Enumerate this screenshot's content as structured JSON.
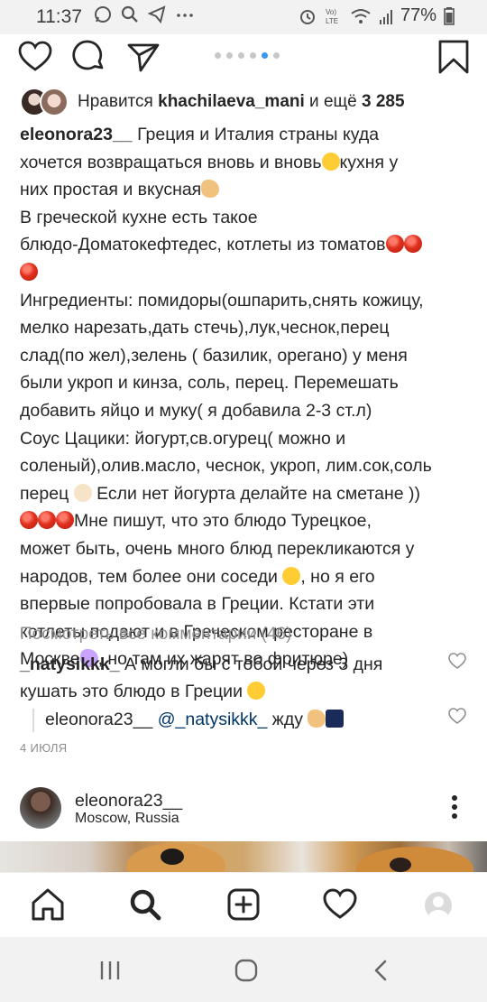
{
  "status_bar": {
    "time": "11:37",
    "battery": "77%"
  },
  "post": {
    "likes": {
      "prefix": "Нравится ",
      "user": "khachilaeva_mani",
      "middle": " и ещё ",
      "count": "3 285"
    },
    "caption": {
      "user": "eleonora23__",
      "l1": " Греция и Италия страны куда",
      "l2": "хочется возвращаться вновь и вновь",
      "l2b": "кухня у",
      "l3": "них простая и вкусная",
      "l4": "В греческой кухне есть такое",
      "l5": "блюдо-Доматокефтедес, котлеты из томатов",
      "l7": "Ингредиенты: помидоры(ошпарить,снять кожицу,",
      "l8": "мелко нарезать,дать стечь),лук,чеснок,перец",
      "l9": "слад(по жел),зелень ( базилик, орегано) у меня",
      "l10": "были укроп и кинза, соль, перец. Перемешать",
      "l11": "добавить яйцо и муку( я добавила 2-3 ст.л)",
      "l12": "Соус Цацики: йогурт,св.огурец( можно и",
      "l13": "соленый),олив.масло, чеснок, укроп, лим.сок,соль",
      "l14a": "перец ",
      "l14b": " Если нет йогурта делайте на сметане ))",
      "l15": "Мне пишут, что это блюдо Турецкое,",
      "l16": "может быть, очень много блюд перекликаются у",
      "l17a": "народов, тем более они соседи ",
      "l17b": ", но я его",
      "l18": "впервые попробовала в Греции. Кстати эти",
      "l19": "котлеты подают и в Греческом ресторане в",
      "l20a": "Москве",
      "l20b": ", но там их жарят во фритюре)"
    },
    "view_all_comments": "Посмотреть все комментарии (46)",
    "comments": [
      {
        "user": "_natysikkk_",
        "text": " А могли бы с тобой через 3 дня",
        "text2": "кушать это блюдо в Греции "
      },
      {
        "user": "eleonora23__",
        "mention": "@_natysikkk_",
        "text": " жду "
      }
    ],
    "date": "4 ИЮЛЯ"
  },
  "next_post": {
    "user": "eleonora23__",
    "location": "Moscow, Russia"
  },
  "colors": {
    "accent": "#3897f0",
    "text": "#262626",
    "muted": "#8e8e8e"
  },
  "icons": {
    "actions": [
      "heart-icon",
      "comment-icon",
      "share-icon",
      "bookmark-icon"
    ],
    "nav": [
      "home-icon",
      "search-icon",
      "add-icon",
      "activity-icon",
      "profile-icon"
    ]
  }
}
